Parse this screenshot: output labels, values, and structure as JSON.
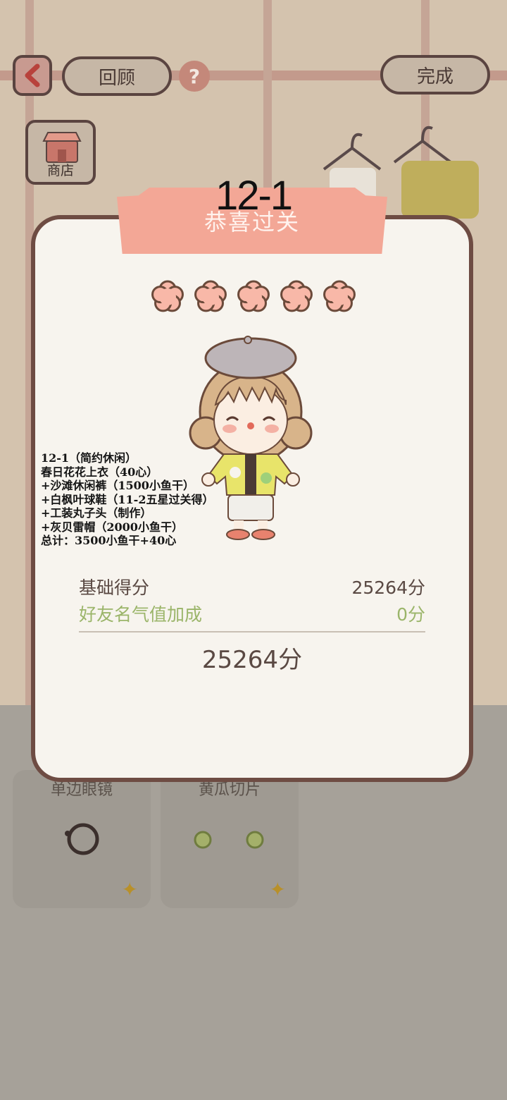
{
  "topbar": {
    "review_label": "回顾",
    "done_label": "完成",
    "help_glyph": "?",
    "shop_label": "商店"
  },
  "background": {
    "cards": [
      {
        "label": "单边眼镜",
        "icon": "monocle-icon"
      },
      {
        "label": "黄瓜切片",
        "icon": "cucumber-slices-icon"
      }
    ]
  },
  "dialog": {
    "level": "12-1",
    "title": "恭喜过关",
    "stars_earned": 5,
    "stars_total": 5,
    "base_score_label": "基础得分",
    "base_score_value": "25264分",
    "bonus_label": "好友名气值加成",
    "bonus_value": "0分",
    "total": "25264分"
  },
  "outfit_notes": [
    "12-1（简约休闲）",
    "春日花花上衣（40心）",
    "+沙滩休闲裤（1500小鱼干）",
    "+白枫叶球鞋（11-2五星过关得）",
    "+工装丸子头（制作）",
    "+灰贝雷帽（2000小鱼干）",
    "总计：3500小鱼干+40心"
  ],
  "colors": {
    "star": "#f8b8a8",
    "ribbon": "#f3a796",
    "bonus_text": "#9bb56a",
    "dialog_border": "#6e4c43"
  }
}
